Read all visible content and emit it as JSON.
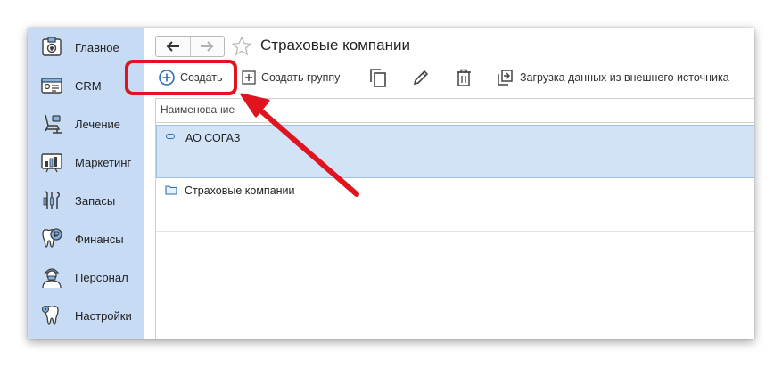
{
  "sidebar": {
    "items": [
      {
        "label": "Главное",
        "icon": "home-icon"
      },
      {
        "label": "CRM",
        "icon": "crm-card-icon"
      },
      {
        "label": "Лечение",
        "icon": "dental-chair-icon"
      },
      {
        "label": "Маркетинг",
        "icon": "marketing-chart-icon"
      },
      {
        "label": "Запасы",
        "icon": "dental-tools-icon"
      },
      {
        "label": "Финансы",
        "icon": "tooth-coin-icon"
      },
      {
        "label": "Персонал",
        "icon": "doctor-icon"
      },
      {
        "label": "Настройки",
        "icon": "tooth-settings-icon"
      }
    ]
  },
  "header": {
    "title": "Страховые компании",
    "back_icon": "arrow-left-icon",
    "forward_icon": "arrow-right-icon",
    "favorite_icon": "star-outline-icon"
  },
  "toolbar": {
    "create_label": "Создать",
    "create_group_label": "Создать группу",
    "load_external_label": "Загрузка данных из внешнего источника"
  },
  "table": {
    "column_header": "Наименование",
    "rows": [
      {
        "name": "АО СОГАЗ",
        "type": "item",
        "selected": true
      },
      {
        "name": "Страховые компании",
        "type": "group",
        "selected": false
      }
    ]
  },
  "annotation": {
    "highlight_color": "#e0141e"
  }
}
